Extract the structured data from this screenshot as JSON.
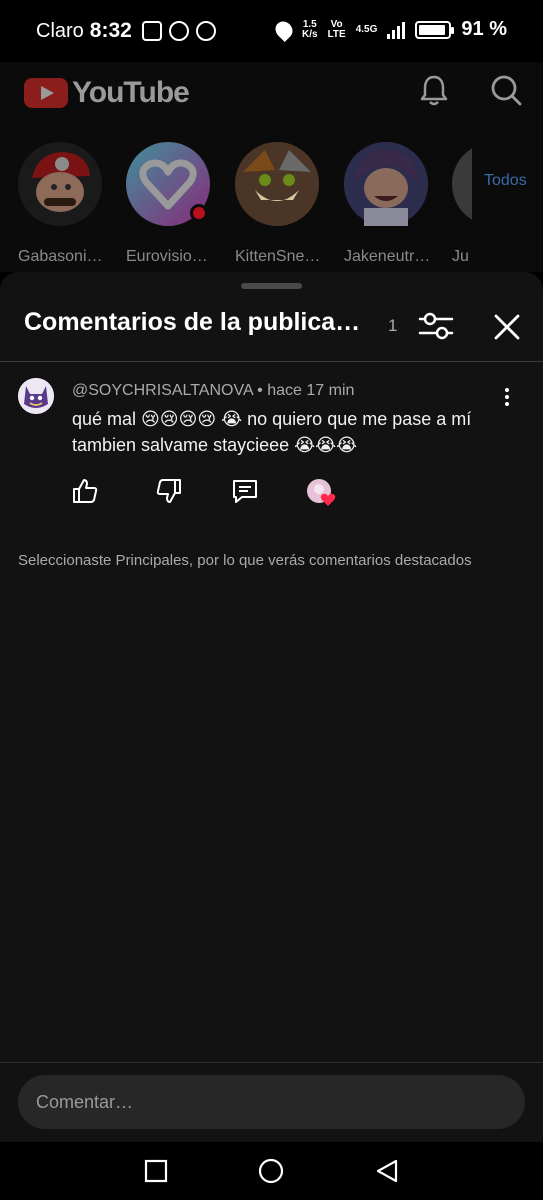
{
  "status_bar": {
    "carrier": "Claro",
    "time": "8:32",
    "net_speed_value": "1.5",
    "net_speed_unit": "K/s",
    "volte_top": "Vo",
    "volte_bottom": "LTE",
    "network_type": "4.5G",
    "battery_percent": "91 %",
    "battery_level": 0.91
  },
  "header": {
    "brand": "YouTube"
  },
  "subscriptions": {
    "items": [
      {
        "name": "Gabasoni…"
      },
      {
        "name": "Eurovisio…"
      },
      {
        "name": "KittenSne…"
      },
      {
        "name": "Jakeneutr…"
      },
      {
        "name": "Ju"
      }
    ],
    "all_label": "Todos"
  },
  "sheet": {
    "title": "Comentarios de la publica…",
    "count": "1"
  },
  "comment": {
    "author": "@SOYCHRISALTANOVA",
    "separator": " • ",
    "time": "hace 17 min",
    "text": "qué mal 😢😢😢😢 😭 no quiero que me pase a mí tambien salvame staycieee 😭😭😭"
  },
  "notice": "Seleccionaste Principales, por lo que verás comentarios destacados",
  "composer": {
    "placeholder": "Comentar…"
  },
  "colors": {
    "sheet_bg": "#121212",
    "accent_red": "#ff0033",
    "link_blue": "#3ea6ff"
  }
}
